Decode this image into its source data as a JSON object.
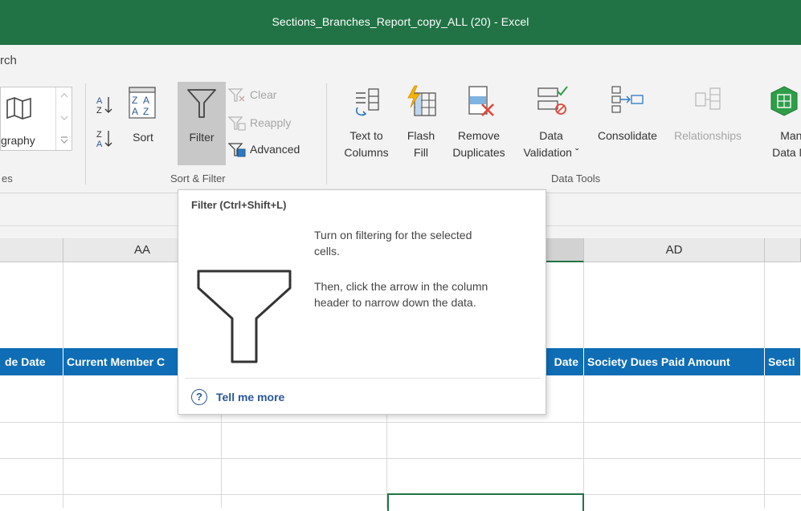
{
  "window": {
    "title": "Sections_Branches_Report_copy_ALL (20)  -  Excel"
  },
  "tabs": {
    "visible_partial": "rch"
  },
  "ribbon": {
    "geography_label": "graphy",
    "types_group_label": "es",
    "sort_filter": {
      "sort_label": "Sort",
      "filter_label": "Filter",
      "clear_label": "Clear",
      "reapply_label": "Reapply",
      "advanced_label": "Advanced",
      "group_label": "Sort & Filter"
    },
    "data_tools": {
      "text_to_columns": [
        "Text to",
        "Columns"
      ],
      "flash_fill": [
        "Flash",
        "Fill"
      ],
      "remove_duplicates": [
        "Remove",
        "Duplicates"
      ],
      "data_validation": [
        "Data",
        "Validation ˇ"
      ],
      "consolidate": "Consolidate",
      "relationships": "Relationships",
      "manage_data_model": [
        "Manag",
        "Data Mo"
      ],
      "group_label": "Data Tools"
    }
  },
  "grid": {
    "columns": [
      {
        "id": "prev",
        "label": ""
      },
      {
        "id": "AA",
        "label": "AA"
      },
      {
        "id": "AB",
        "label": ""
      },
      {
        "id": "AC",
        "label": ""
      },
      {
        "id": "AD",
        "label": "AD"
      },
      {
        "id": "AE",
        "label": ""
      }
    ],
    "header_row": [
      "de Date",
      "Current Member C",
      "",
      "Date",
      "Society Dues Paid Amount",
      "Secti"
    ]
  },
  "tooltip": {
    "title": "Filter (Ctrl+Shift+L)",
    "para1": [
      "Turn on filtering for the selected",
      "cells."
    ],
    "para2": [
      "Then, click the arrow in the column",
      "header to narrow down the data."
    ],
    "tell_me_more": "Tell me more",
    "help_glyph": "?"
  },
  "colors": {
    "title_bar": "#217346",
    "header_fill": "#0e6db5",
    "link": "#2b579a"
  }
}
